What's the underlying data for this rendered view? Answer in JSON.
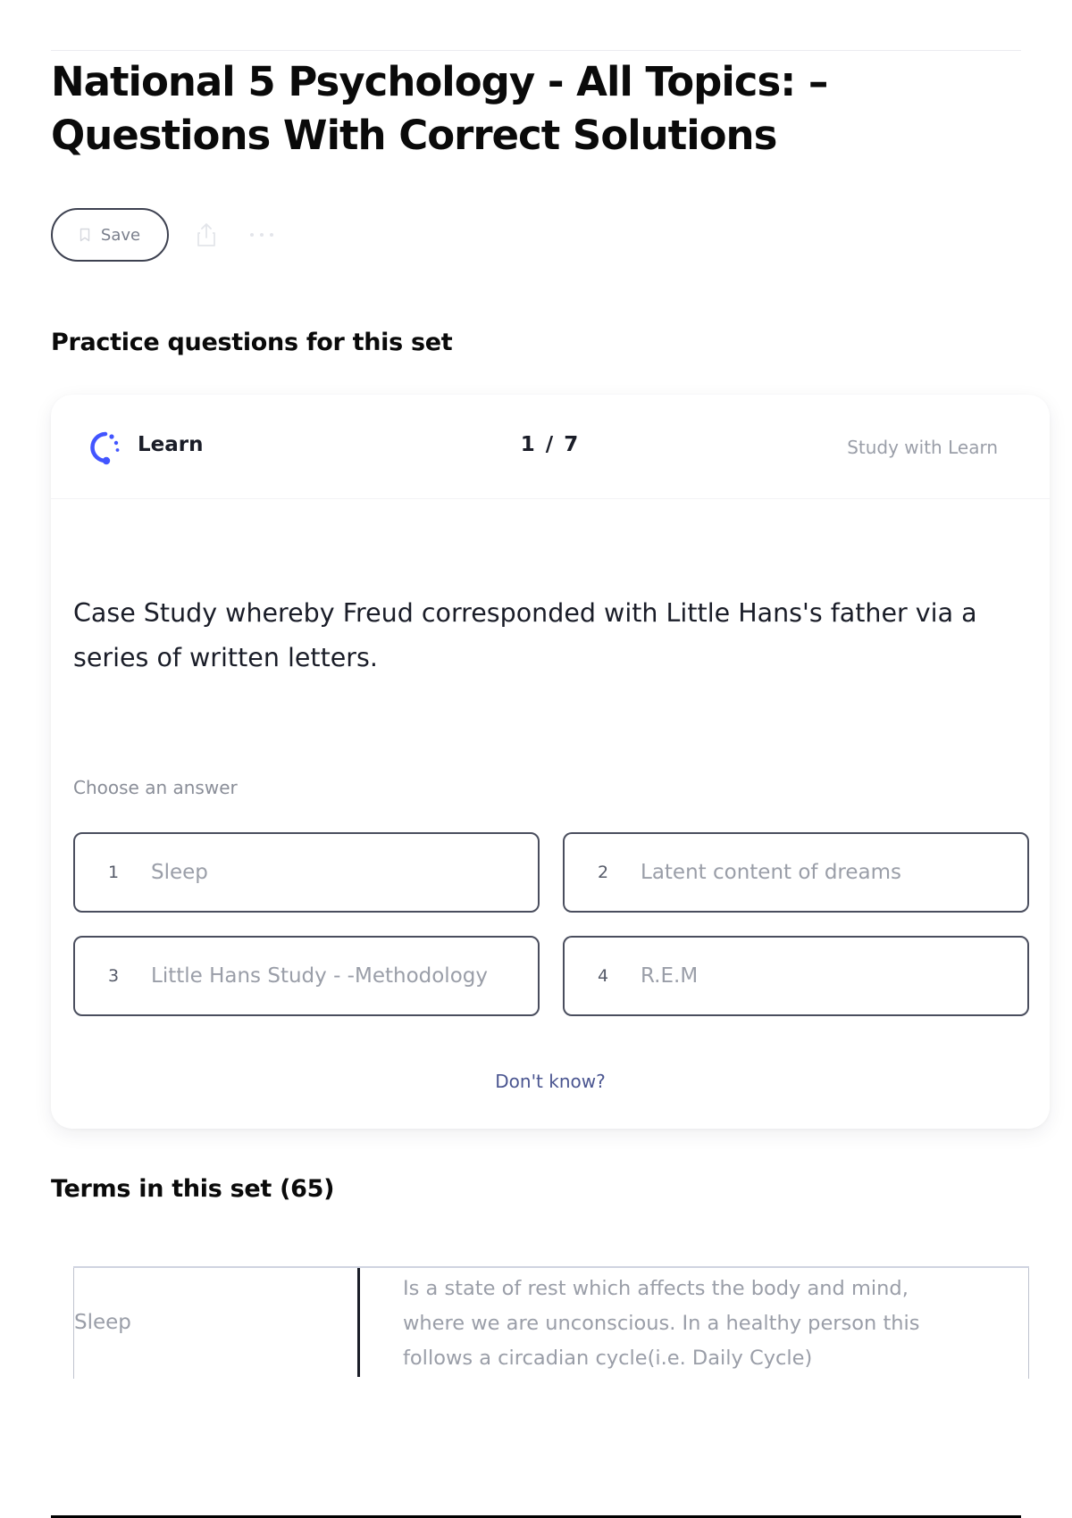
{
  "page": {
    "title": "National 5 Psychology - All Topics: – Questions With Correct Solutions"
  },
  "actions": {
    "save_label": "Save"
  },
  "practice": {
    "heading": "Practice questions for this set",
    "learn_label": "Learn",
    "progress": "1 / 7",
    "study_link": "Study with Learn",
    "question": "Case Study whereby Freud corresponded with Little Hans's father via a series of written letters.",
    "choose_label": "Choose an answer",
    "answers": [
      {
        "num": "1",
        "text": "Sleep"
      },
      {
        "num": "2",
        "text": "Latent content of dreams"
      },
      {
        "num": "3",
        "text": "Little Hans Study - -Methodology"
      },
      {
        "num": "4",
        "text": "R.E.M"
      }
    ],
    "dont_know": "Don't know?"
  },
  "terms": {
    "heading": "Terms in this set (65)",
    "rows": [
      {
        "term": "Sleep",
        "definition": "Is a state of rest which affects the body and mind, where we are unconscious. In a healthy person this follows a circadian cycle(i.e. Daily Cycle)"
      }
    ]
  },
  "colors": {
    "accent": "#4255ff",
    "text": "#1a1d28",
    "muted": "#9a9ea8",
    "link": "#4a5590"
  },
  "icons": {
    "save": "bookmark-icon",
    "share": "share-icon",
    "more": "more-horizontal-icon",
    "learn": "learn-logo-icon"
  }
}
